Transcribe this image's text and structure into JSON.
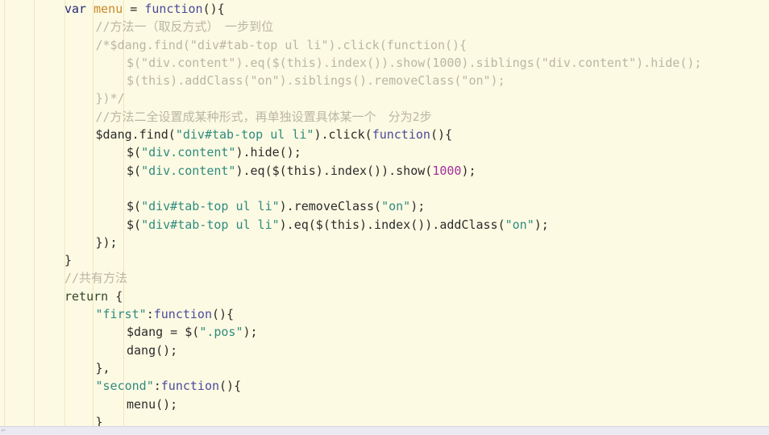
{
  "editor": {
    "background_color": "#fdfae3",
    "font_size_px": 15,
    "line_height_px": 22.3,
    "language": "javascript",
    "guides_color": "#efe8c4"
  },
  "colors": {
    "keyword": "#2a2a7a",
    "function_keyword": "#4a4a9e",
    "return_keyword": "#34452b",
    "identifier_highlight": "#c78a2c",
    "string": "#2e8b7f",
    "number": "#a0309a",
    "plain": "#2b2b2b",
    "comment": "#b9b6a4",
    "statusbar": "#ebe9f2"
  },
  "code": {
    "lines": [
      {
        "id": 1,
        "indent": 0,
        "tokens": [
          {
            "t": "var",
            "c": "kw"
          },
          {
            "t": " ",
            "c": "plain"
          },
          {
            "t": "menu",
            "c": "fn"
          },
          {
            "t": " = ",
            "c": "plain"
          },
          {
            "t": "function",
            "c": "kw2"
          },
          {
            "t": "(){",
            "c": "plain"
          }
        ]
      },
      {
        "id": 2,
        "indent": 1,
        "tokens": [
          {
            "t": "//方法一（取反方式）　一步到位",
            "c": "cmt"
          }
        ]
      },
      {
        "id": 3,
        "indent": 1,
        "tokens": [
          {
            "t": "/*$dang.find(\"div#tab-top ul li\").click(function(){",
            "c": "cmt"
          }
        ]
      },
      {
        "id": 4,
        "indent": 2,
        "tokens": [
          {
            "t": "$(\"div.content\").eq($(this).index()).show(1000).siblings(\"div.content\").hide();",
            "c": "cmt"
          }
        ]
      },
      {
        "id": 5,
        "indent": 2,
        "tokens": [
          {
            "t": "$(this).addClass(\"on\").siblings().removeClass(\"on\");",
            "c": "cmt"
          }
        ]
      },
      {
        "id": 6,
        "indent": 1,
        "tokens": [
          {
            "t": "})*/",
            "c": "cmt"
          }
        ]
      },
      {
        "id": 7,
        "indent": 1,
        "tokens": [
          {
            "t": "//方法二全设置成某种形式，再单独设置具体某一个　分为2步",
            "c": "cmt"
          }
        ]
      },
      {
        "id": 8,
        "indent": 1,
        "tokens": [
          {
            "t": "$dang.find(",
            "c": "plain"
          },
          {
            "t": "\"div#tab-top ul li\"",
            "c": "str"
          },
          {
            "t": ").click(",
            "c": "plain"
          },
          {
            "t": "function",
            "c": "kw2"
          },
          {
            "t": "(){",
            "c": "plain"
          }
        ]
      },
      {
        "id": 9,
        "indent": 2,
        "tokens": [
          {
            "t": "$(",
            "c": "plain"
          },
          {
            "t": "\"div.content\"",
            "c": "str"
          },
          {
            "t": ").hide();",
            "c": "plain"
          }
        ]
      },
      {
        "id": 10,
        "indent": 2,
        "tokens": [
          {
            "t": "$(",
            "c": "plain"
          },
          {
            "t": "\"div.content\"",
            "c": "str"
          },
          {
            "t": ").eq($(this).index()).show(",
            "c": "plain"
          },
          {
            "t": "1000",
            "c": "num"
          },
          {
            "t": ");",
            "c": "plain"
          }
        ]
      },
      {
        "id": 11,
        "indent": 0,
        "tokens": []
      },
      {
        "id": 12,
        "indent": 2,
        "tokens": [
          {
            "t": "$(",
            "c": "plain"
          },
          {
            "t": "\"div#tab-top ul li\"",
            "c": "str"
          },
          {
            "t": ").removeClass(",
            "c": "plain"
          },
          {
            "t": "\"on\"",
            "c": "str"
          },
          {
            "t": ");",
            "c": "plain"
          }
        ]
      },
      {
        "id": 13,
        "indent": 2,
        "tokens": [
          {
            "t": "$(",
            "c": "plain"
          },
          {
            "t": "\"div#tab-top ul li\"",
            "c": "str"
          },
          {
            "t": ").eq($(this).index()).addClass(",
            "c": "plain"
          },
          {
            "t": "\"on\"",
            "c": "str"
          },
          {
            "t": ");",
            "c": "plain"
          }
        ]
      },
      {
        "id": 14,
        "indent": 1,
        "tokens": [
          {
            "t": "});",
            "c": "plain"
          }
        ]
      },
      {
        "id": 15,
        "indent": 0,
        "tokens": [
          {
            "t": "}",
            "c": "plain"
          }
        ]
      },
      {
        "id": 16,
        "indent": 0,
        "tokens": [
          {
            "t": "//共有方法",
            "c": "cmt"
          }
        ]
      },
      {
        "id": 17,
        "indent": 0,
        "tokens": [
          {
            "t": "return",
            "c": "ret"
          },
          {
            "t": " {",
            "c": "plain"
          }
        ]
      },
      {
        "id": 18,
        "indent": 1,
        "tokens": [
          {
            "t": "\"first\"",
            "c": "str"
          },
          {
            "t": ":",
            "c": "plain"
          },
          {
            "t": "function",
            "c": "kw2"
          },
          {
            "t": "(){",
            "c": "plain"
          }
        ]
      },
      {
        "id": 19,
        "indent": 2,
        "tokens": [
          {
            "t": "$dang = $(",
            "c": "plain"
          },
          {
            "t": "\".pos\"",
            "c": "str"
          },
          {
            "t": ");",
            "c": "plain"
          }
        ]
      },
      {
        "id": 20,
        "indent": 2,
        "tokens": [
          {
            "t": "dang();",
            "c": "plain"
          }
        ]
      },
      {
        "id": 21,
        "indent": 1,
        "tokens": [
          {
            "t": "},",
            "c": "plain"
          }
        ]
      },
      {
        "id": 22,
        "indent": 1,
        "tokens": [
          {
            "t": "\"second\"",
            "c": "str"
          },
          {
            "t": ":",
            "c": "plain"
          },
          {
            "t": "function",
            "c": "kw2"
          },
          {
            "t": "(){",
            "c": "plain"
          }
        ]
      },
      {
        "id": 23,
        "indent": 2,
        "tokens": [
          {
            "t": "menu();",
            "c": "plain"
          }
        ]
      },
      {
        "id": 24,
        "indent": 1,
        "tokens": [
          {
            "t": "}",
            "c": "plain"
          }
        ]
      }
    ]
  },
  "statusbar": {
    "caret_glyph": "⌐"
  }
}
